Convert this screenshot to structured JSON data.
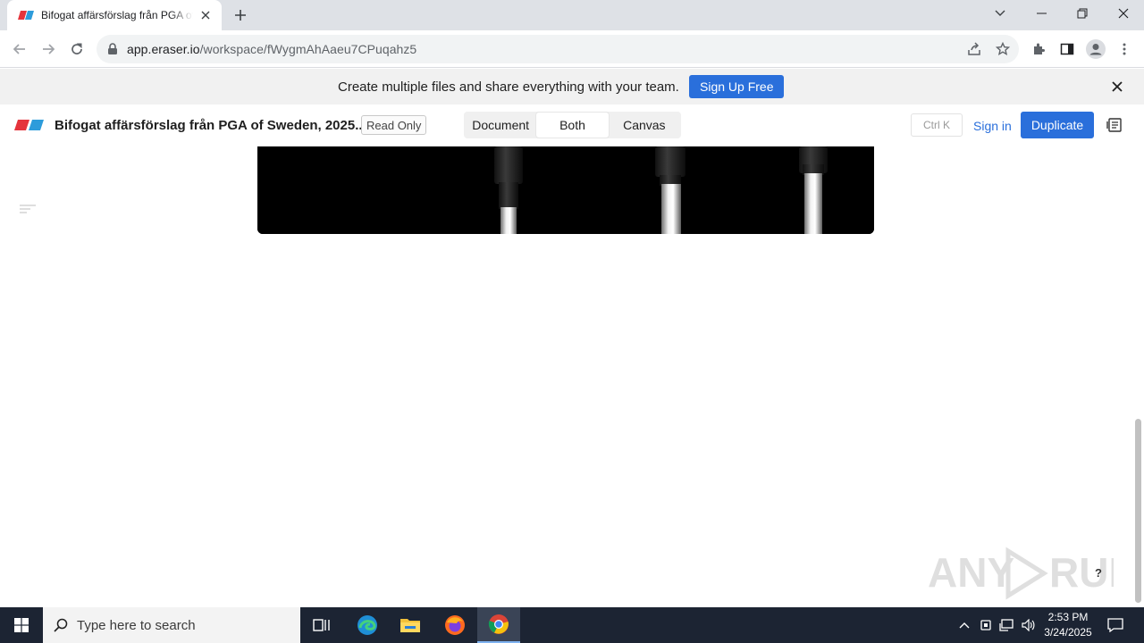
{
  "browser": {
    "tab_title": "Bifogat affärsförslag från PGA of Sweden, 2025...",
    "url_host": "app.eraser.io",
    "url_path": "/workspace/fWygmAhAaeu7CPuqahz5"
  },
  "banner": {
    "message": "Create multiple files and share everything with your team.",
    "signup_label": "Sign Up Free"
  },
  "app_header": {
    "doc_title": "Bifogat affärsförslag från PGA of Sweden, 2025...",
    "readonly_badge": "Read Only",
    "view_options": [
      "Document",
      "Both",
      "Canvas"
    ],
    "active_view": "Both",
    "shortcut_hint": "Ctrl K",
    "signin_label": "Sign in",
    "duplicate_label": "Duplicate"
  },
  "content": {
    "help_label": "?",
    "watermark_text": "ANY RUN"
  },
  "taskbar": {
    "search_placeholder": "Type here to search",
    "time": "2:53 PM",
    "date": "3/24/2025"
  },
  "colors": {
    "accent_blue": "#2a6fdb",
    "logo_red": "#e5343c",
    "logo_blue": "#2d9cdb",
    "taskbar_bg": "#1c2433"
  },
  "icons": [
    "eraser-logo-icon",
    "close-icon",
    "plus-icon",
    "chevron-down-icon",
    "minimize-icon",
    "restore-icon",
    "back-icon",
    "forward-icon",
    "reload-icon",
    "lock-icon",
    "share-icon",
    "star-icon",
    "extensions-icon",
    "sidepanel-icon",
    "profile-icon",
    "kebab-menu-icon",
    "outline-icon",
    "panel-icon",
    "windows-start-icon",
    "search-icon",
    "task-view-icon",
    "edge-icon",
    "file-explorer-icon",
    "firefox-icon",
    "chrome-icon",
    "tray-chevron-icon",
    "network-icon",
    "volume-icon",
    "notification-icon"
  ]
}
